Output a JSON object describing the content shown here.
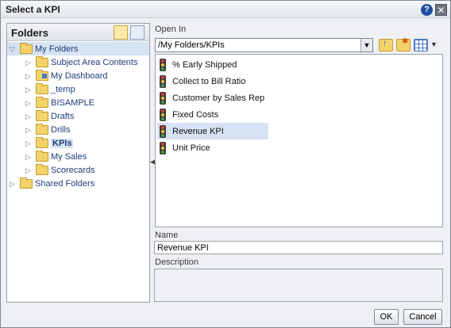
{
  "dialog": {
    "title": "Select a KPI"
  },
  "folders": {
    "header": "Folders",
    "tree": [
      {
        "label": "My Folders",
        "level": 0,
        "expanded": true,
        "selected": true
      },
      {
        "label": "Subject Area Contents",
        "level": 1
      },
      {
        "label": "My Dashboard",
        "level": 1
      },
      {
        "label": "_temp",
        "level": 1
      },
      {
        "label": "BISAMPLE",
        "level": 1
      },
      {
        "label": "Drafts",
        "level": 1
      },
      {
        "label": "Drills",
        "level": 1
      },
      {
        "label": "KPIs",
        "level": 1,
        "current": true
      },
      {
        "label": "My Sales",
        "level": 1
      },
      {
        "label": "Scorecards",
        "level": 1
      },
      {
        "label": "Shared Folders",
        "level": 0
      }
    ]
  },
  "open_in": {
    "label": "Open In",
    "path": "/My Folders/KPIs"
  },
  "items": [
    {
      "label": "% Early Shipped"
    },
    {
      "label": "Collect to Bill Ratio"
    },
    {
      "label": "Customer by Sales Rep"
    },
    {
      "label": "Fixed Costs"
    },
    {
      "label": "Revenue KPI",
      "selected": true
    },
    {
      "label": "Unit Price"
    }
  ],
  "name": {
    "label": "Name",
    "value": "Revenue KPI"
  },
  "description": {
    "label": "Description",
    "value": ""
  },
  "buttons": {
    "ok": "OK",
    "cancel": "Cancel"
  },
  "colors": {
    "selection": "#d6e3f2",
    "link": "#1f3d7a"
  }
}
